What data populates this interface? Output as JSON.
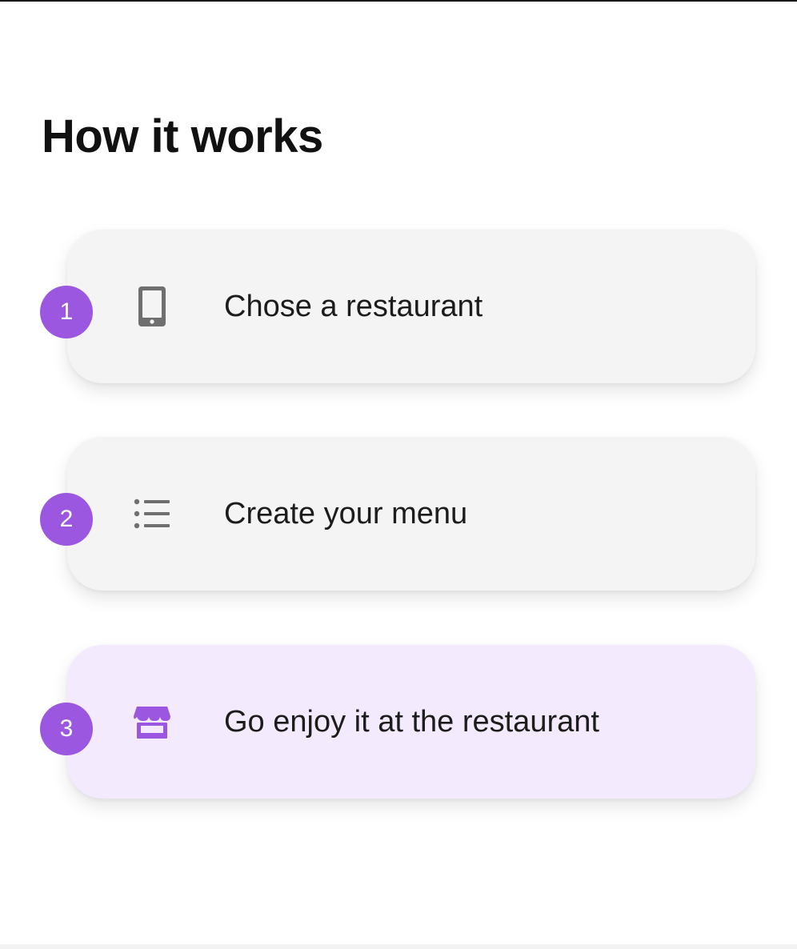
{
  "title": "How it works",
  "accent_color": "#9b57e0",
  "steps": [
    {
      "number": "1",
      "label": "Chose a restaurant",
      "icon": "smartphone-icon",
      "active": false
    },
    {
      "number": "2",
      "label": "Create your menu",
      "icon": "list-icon",
      "active": false
    },
    {
      "number": "3",
      "label": "Go enjoy it at the restaurant",
      "icon": "storefront-icon",
      "active": true
    }
  ]
}
